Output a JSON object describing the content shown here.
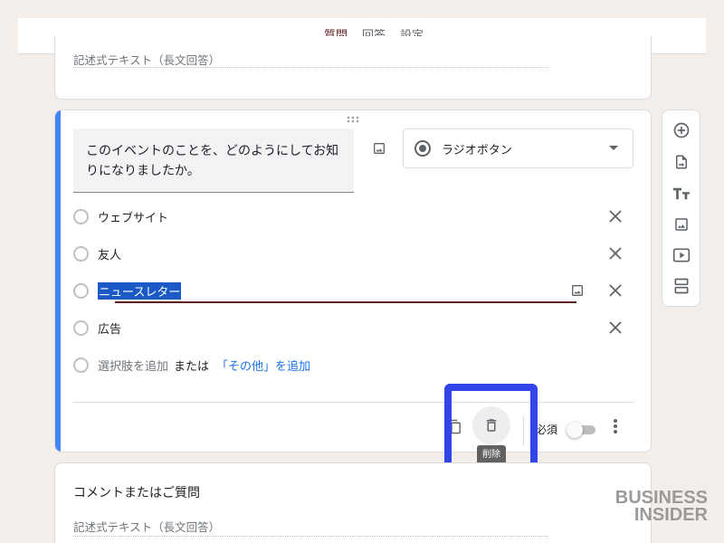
{
  "tabs": [
    {
      "label": "質問",
      "active": true
    },
    {
      "label": "回答",
      "active": false
    },
    {
      "label": "設定",
      "active": false
    }
  ],
  "top_card": {
    "answer_placeholder": "記述式テキスト（長文回答）"
  },
  "question": {
    "title": "このイベントのことを、どのようにしてお知りになりましたか。",
    "type_label": "ラジオボタン",
    "options": [
      {
        "label": "ウェブサイト",
        "selected": false
      },
      {
        "label": "友人",
        "selected": false
      },
      {
        "label": "ニュースレター",
        "selected": true
      },
      {
        "label": "広告",
        "selected": false
      }
    ],
    "add_option": "選択肢を追加",
    "or_text": "または",
    "add_other": "「その他」を追加",
    "required_label": "必須",
    "delete_tooltip": "削除"
  },
  "bottom_card": {
    "title": "コメントまたはご質問",
    "answer_placeholder": "記述式テキスト（長文回答）"
  },
  "watermark": {
    "line1": "BUSINESS",
    "line2": "INSIDER"
  },
  "colors": {
    "accent_tab": "#5d1f1f",
    "question_bar": "#4285f4",
    "highlight_box": "#3145e8",
    "link": "#1a73e8"
  }
}
